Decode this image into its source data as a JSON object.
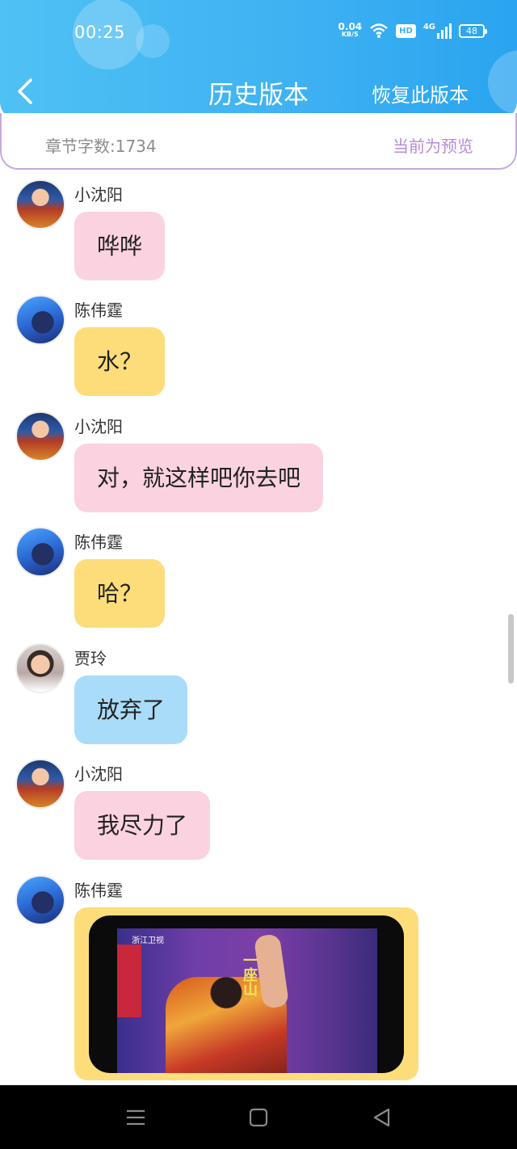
{
  "status_bar": {
    "time": "00:25",
    "net_speed_value": "0.04",
    "net_speed_unit": "KB/S",
    "hd_label": "HD",
    "network_label": "4G",
    "battery": "48"
  },
  "header": {
    "title": "历史版本",
    "restore_label": "恢复此版本",
    "back_icon": "chevron-left-icon"
  },
  "info_bar": {
    "word_count": "章节字数:1734",
    "preview_label": "当前为预览"
  },
  "messages": [
    {
      "sender": "小沈阳",
      "text": "哗哗",
      "color": "#fbd2df"
    },
    {
      "sender": "陈伟霆",
      "text": "水？",
      "color": "#fcdd7a"
    },
    {
      "sender": "小沈阳",
      "text": "对，就这样吧你去吧",
      "color": "#fbd2df"
    },
    {
      "sender": "陈伟霆",
      "text": "哈？",
      "color": "#fcdd7a"
    },
    {
      "sender": "贾玲",
      "text": "放弃了",
      "color": "#a9dcf8"
    },
    {
      "sender": "小沈阳",
      "text": "我尽力了",
      "color": "#fbd2df"
    },
    {
      "sender": "陈伟霆",
      "text": "",
      "color": "#fcdd7a"
    }
  ],
  "image_message": {
    "channel_logo": "浙江卫视",
    "caption": "一座山"
  },
  "nav_bar": {
    "menu_icon": "menu-icon",
    "home_icon": "home-square-icon",
    "back_icon": "back-triangle-icon"
  },
  "colors": {
    "header_blue": "#3fb2f2",
    "accent_purple": "#b58bd6",
    "bubble_pink": "#fbd2df",
    "bubble_yellow": "#fcdd7a",
    "bubble_blue": "#a9dcf8"
  }
}
